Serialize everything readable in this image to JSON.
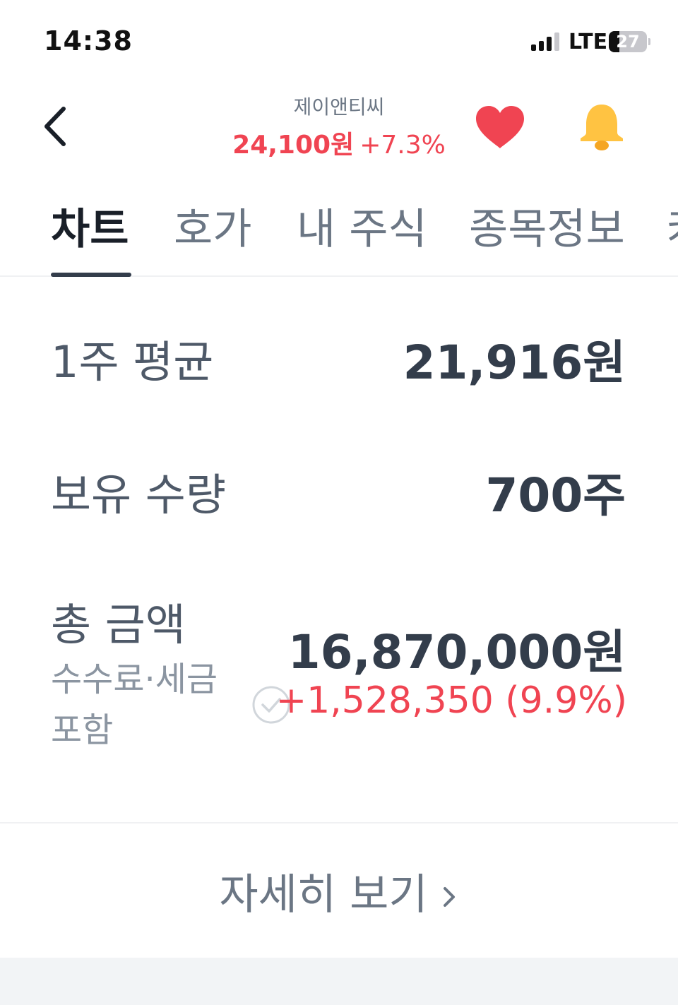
{
  "status_bar": {
    "time": "14:38",
    "network": "LTE",
    "battery_level": "27",
    "battery_fraction": 0.27,
    "signal_bars": 3,
    "signal_bars_total": 4
  },
  "header": {
    "stock_name": "제이앤티씨",
    "price": "24,100원",
    "change": "+7.3%",
    "back_icon": "chevron-left-icon",
    "favorite_icon": "heart-icon",
    "alert_icon": "bell-icon",
    "up_color": "#f04452",
    "favorite_color": "#f04452",
    "alert_color": "#ffc342"
  },
  "tabs": [
    {
      "label": "차트",
      "active": true
    },
    {
      "label": "호가",
      "active": false
    },
    {
      "label": "내 주식",
      "active": false
    },
    {
      "label": "종목정보",
      "active": false
    },
    {
      "label": "커",
      "active": false
    }
  ],
  "holdings": {
    "avg_label": "1주 평균",
    "avg_value": "21,916원",
    "qty_label": "보유 수량",
    "qty_value": "700주",
    "total_label": "총 금액",
    "total_value": "16,870,000원",
    "fee_label": "수수료·세금 포함",
    "fee_included": false,
    "profit": "+1,528,350 (9.9%)"
  },
  "footer": {
    "detail_label": "자세히 보기",
    "detail_icon": "chevron-right-icon"
  }
}
